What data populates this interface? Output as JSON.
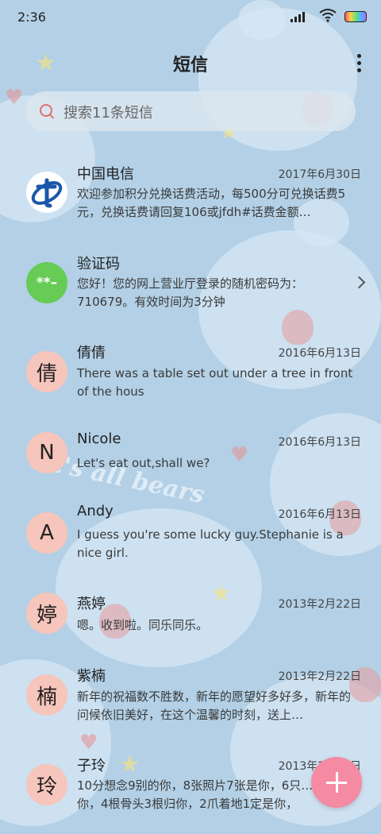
{
  "status": {
    "time": "2:36"
  },
  "header": {
    "title": "短信"
  },
  "search": {
    "placeholder": "搜索11条短信"
  },
  "background": {
    "text": "It's all bears"
  },
  "messages": [
    {
      "avatar": "",
      "name": "中国电信",
      "date": "2017年6月30日",
      "preview": "欢迎参加积分兑换话费活动，每500分可兑换话费5元，兑换话费请回复106或jfdh#话费金额…"
    },
    {
      "avatar": "**–",
      "name": "验证码",
      "date": "",
      "preview": "您好！您的网上营业厅登录的随机密码为：710679。有效时间为3分钟"
    },
    {
      "avatar": "倩",
      "name": "倩倩",
      "date": "2016年6月13日",
      "preview": "There was a table set out under a tree in front of the hous"
    },
    {
      "avatar": "N",
      "name": "Nicole",
      "date": "2016年6月13日",
      "preview": "Let's eat out,shall we?"
    },
    {
      "avatar": "A",
      "name": "Andy",
      "date": "2016年6月13日",
      "preview": "I guess you're some lucky guy.Stephanie is a nice girl."
    },
    {
      "avatar": "婷",
      "name": "燕婷",
      "date": "2013年2月22日",
      "preview": "嗯。收到啦。同乐同乐。"
    },
    {
      "avatar": "楠",
      "name": "紫楠",
      "date": "2013年2月22日",
      "preview": "新年的祝福数不胜数，新年的愿望好多好多，新年的问候依旧美好，在这个温馨的时刻，送上…"
    },
    {
      "avatar": "玲",
      "name": "子玲",
      "date": "2013年2月22日",
      "preview": "10分想念9别的你，8张照片7张是你，6只…只像你，4根骨头3根归你，2爪着地1定是你，"
    }
  ],
  "colors": {
    "fab": "#f58aa3",
    "avatar": "#f6c5bb",
    "verify": "#66cc55",
    "background": "#b3d0e6"
  }
}
